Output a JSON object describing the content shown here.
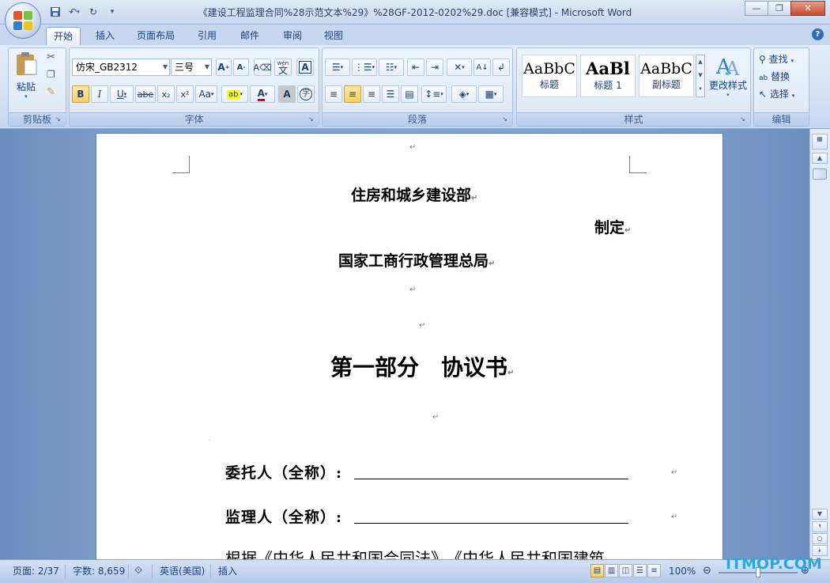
{
  "window": {
    "title": "《建设工程监理合同%28示范文本%29》%28GF-2012-0202%29.doc [兼容模式] - Microsoft Word"
  },
  "tabs": [
    {
      "label": "开始",
      "active": true
    },
    {
      "label": "插入"
    },
    {
      "label": "页面布局"
    },
    {
      "label": "引用"
    },
    {
      "label": "邮件"
    },
    {
      "label": "审阅"
    },
    {
      "label": "视图"
    }
  ],
  "ribbon": {
    "clipboard": {
      "group_label": "剪贴板",
      "paste_label": "粘贴"
    },
    "font": {
      "group_label": "字体",
      "font_name": "仿宋_GB2312",
      "font_size": "三号",
      "bold": "B",
      "italic": "I",
      "underline": "U",
      "strike": "abe",
      "subscript": "x₂",
      "superscript": "x²",
      "change_case": "Aa",
      "grow": "A",
      "shrink": "A",
      "phonetic": "wén",
      "phonetic_char": "文",
      "border_char": "A",
      "shade_char": "A",
      "enclose_char": "字"
    },
    "paragraph": {
      "group_label": "段落"
    },
    "styles": {
      "group_label": "样式",
      "items": [
        {
          "sample": "AaBbC",
          "name": "标题"
        },
        {
          "sample": "AaBl",
          "name": "标题 1"
        },
        {
          "sample": "AaBbC",
          "name": "副标题"
        }
      ],
      "change_styles": "更改样式"
    },
    "editing": {
      "group_label": "编辑",
      "find": "查找",
      "replace": "替换",
      "select": "选择"
    }
  },
  "document": {
    "line1": "住房和城乡建设部",
    "line2": "制定",
    "line3": "国家工商行政管理总局",
    "heading": "第一部分　协议书",
    "field1_label": "委托人（全称）:",
    "field2_label": "监理人（全称）:",
    "body_partial": "根据《中华人民共和国合同法》、《中华人民共和国建筑"
  },
  "status": {
    "page": "页面: 2/37",
    "words": "字数: 8,659",
    "language": "英语(美国)",
    "mode": "插入",
    "zoom": "100%"
  },
  "watermark": "ITMOP.COM",
  "colors": {
    "ribbon_bg": "#d4e2f4",
    "accent": "#15428b",
    "close": "#c24b2e"
  }
}
